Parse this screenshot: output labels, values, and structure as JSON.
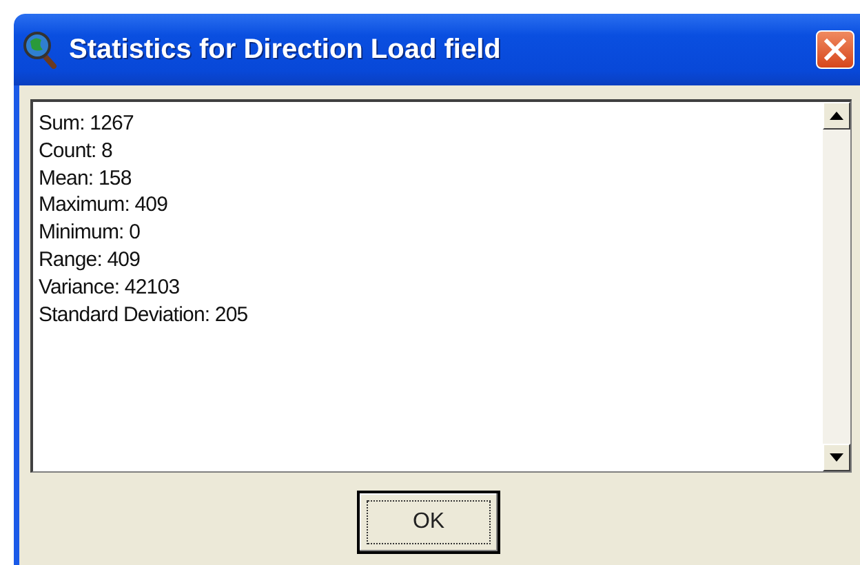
{
  "window": {
    "title": "Statistics for Direction Load field"
  },
  "statistics": [
    "Sum: 1267",
    "Count: 8",
    "Mean: 158",
    "Maximum: 409",
    "Minimum: 0",
    "Range: 409",
    "Variance: 42103",
    "Standard Deviation: 205"
  ],
  "button": {
    "label": "OK",
    "focused": true
  }
}
